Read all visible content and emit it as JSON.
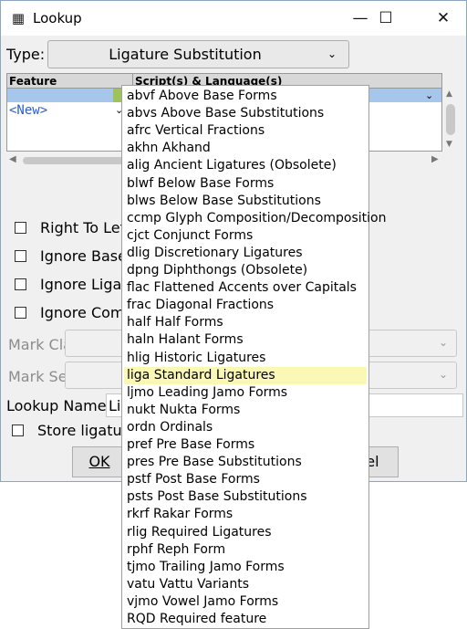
{
  "window": {
    "title": "Lookup",
    "icon": "fontforge-app-icon",
    "minimize_glyph": "—",
    "maximize_glyph": "☐",
    "close_glyph": "✕"
  },
  "type_field": {
    "label": "Type:",
    "value": "Ligature Substitution",
    "arrow": "⌄"
  },
  "table": {
    "columns": [
      "Feature",
      "Script(s) & Language(s)"
    ],
    "new_row": "<New>",
    "row_arrow": "⌄"
  },
  "flags": {
    "right_to_left": "Right To Lef",
    "ignore_base": "Ignore Base",
    "ignore_ligatures": "Ignore Ligat",
    "ignore_combining": "Ignore Coml"
  },
  "mark_class": {
    "label": "Mark Class:"
  },
  "mark_set": {
    "label": "Mark Set:"
  },
  "lookup_name": {
    "label": "Lookup Name:",
    "value": "Li"
  },
  "store_ligatures": {
    "label": "Store ligatur"
  },
  "buttons": {
    "ok": "OK",
    "cancel_fragment": "cel"
  },
  "dropdown": {
    "selected_index": 14,
    "items": [
      "abvf Above Base Forms",
      "abvs Above Base Substitutions",
      "afrc Vertical Fractions",
      "akhn Akhand",
      "alig Ancient Ligatures (Obsolete)",
      "blwf Below Base Forms",
      "blws Below Base Substitutions",
      "ccmp Glyph Composition/Decomposition",
      "cjct Conjunct Forms",
      "dlig Discretionary Ligatures",
      "dpng Diphthongs (Obsolete)",
      "flac Flattened Accents over Capitals",
      "frac Diagonal Fractions",
      "half Half Forms",
      "haln Halant Forms",
      "hlig Historic Ligatures",
      "liga Standard Ligatures",
      "ljmo Leading Jamo Forms",
      "nukt Nukta Forms",
      "ordn Ordinals",
      "pref Pre Base Forms",
      "pres Pre Base Substitutions",
      "pstf Post Base Forms",
      "psts Post Base Substitutions",
      "rkrf Rakar Forms",
      "rlig Required Ligatures",
      "rphf Reph Form",
      "tjmo Trailing Jamo Forms",
      "vatu Vattu Variants",
      "vjmo Vowel Jamo Forms",
      " RQD Required feature"
    ]
  }
}
